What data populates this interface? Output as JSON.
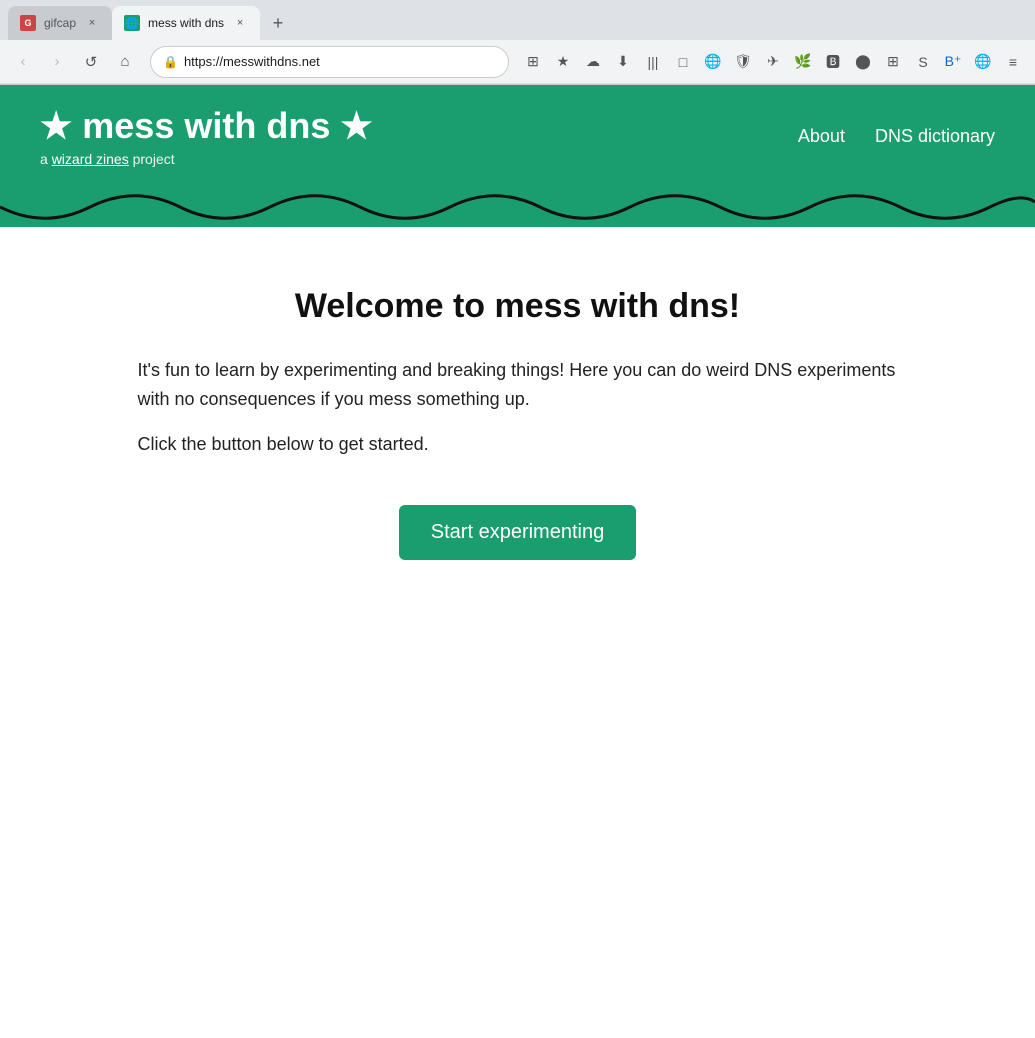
{
  "browser": {
    "tabs": [
      {
        "id": "tab-gifcap",
        "favicon": "G",
        "favicon_color": "#cc4444",
        "title": "gifcap",
        "active": false,
        "close_label": "×"
      },
      {
        "id": "tab-dns",
        "favicon": "🌐",
        "favicon_color": "#1a9e70",
        "title": "mess with dns",
        "active": true,
        "close_label": "×"
      }
    ],
    "new_tab_label": "+",
    "nav": {
      "back_label": "‹",
      "forward_label": "›",
      "reload_label": "↺",
      "home_label": "⌂",
      "address": "https://messwithdns.net"
    },
    "toolbar_icons": [
      "⊞",
      "★",
      "☁",
      "⬇",
      "|||",
      "□",
      "🌐",
      "🔒",
      "✈",
      "🌿",
      "🅱",
      "🔵",
      "⊞",
      "S",
      "B+",
      "🌐",
      "≡"
    ]
  },
  "site": {
    "header": {
      "title": "★ mess with dns ★",
      "subtitle_pre": "a ",
      "subtitle_link": "wizard zines",
      "subtitle_post": " project",
      "nav_items": [
        "About",
        "DNS dictionary"
      ],
      "bg_color": "#1a9e70"
    },
    "main": {
      "welcome_title": "Welcome to mess with dns!",
      "paragraph1": "It's fun to learn by experimenting and breaking things! Here you can do weird DNS experiments with no consequences if you mess something up.",
      "paragraph2": "Click the button below to get started.",
      "cta_button": "Start experimenting"
    }
  }
}
